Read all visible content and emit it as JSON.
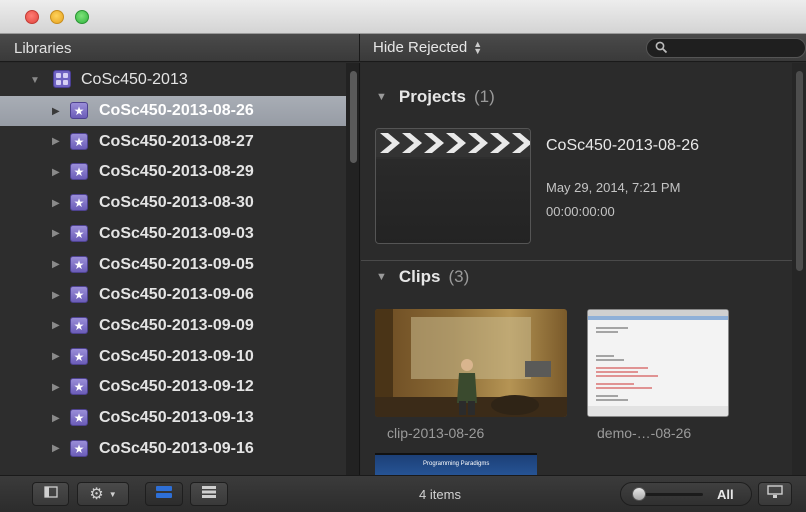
{
  "sidebar": {
    "header": "Libraries",
    "library": "CoSc450-2013",
    "events": [
      "CoSc450-2013-08-26",
      "CoSc450-2013-08-27",
      "CoSc450-2013-08-29",
      "CoSc450-2013-08-30",
      "CoSc450-2013-09-03",
      "CoSc450-2013-09-05",
      "CoSc450-2013-09-06",
      "CoSc450-2013-09-09",
      "CoSc450-2013-09-10",
      "CoSc450-2013-09-12",
      "CoSc450-2013-09-13",
      "CoSc450-2013-09-16"
    ],
    "selected_index": 0
  },
  "browser": {
    "filter": "Hide Rejected",
    "projects": {
      "label": "Projects",
      "count": "(1)"
    },
    "project": {
      "title": "CoSc450-2013-08-26",
      "date": "May 29, 2014, 7:21 PM",
      "duration": "00:00:00:00"
    },
    "clips": {
      "label": "Clips",
      "count": "(3)"
    },
    "clip_items": [
      "clip-2013-08-26",
      "demo-…-08-26"
    ],
    "third_clip_text": "Programming Paradigms"
  },
  "footer": {
    "items": "4 items",
    "zoom_label": "All"
  },
  "icons": {
    "close": "close-button",
    "minimize": "minimize-button",
    "zoom": "zoom-window-button",
    "search": "search-icon",
    "library": "library-icon",
    "event": "event-star-icon",
    "disclosure": "disclosure-triangle-icon",
    "sidebar_toggle": "sidebar-toggle-icon",
    "gear": "gear-icon",
    "filmstrip_view": "filmstrip-view-icon",
    "list_view": "list-view-icon",
    "appearance": "clip-appearance-icon"
  },
  "colors": {
    "selection": "#9fa4ad",
    "accent_blue": "#2e6fd6",
    "panel": "#2b2b2b"
  }
}
